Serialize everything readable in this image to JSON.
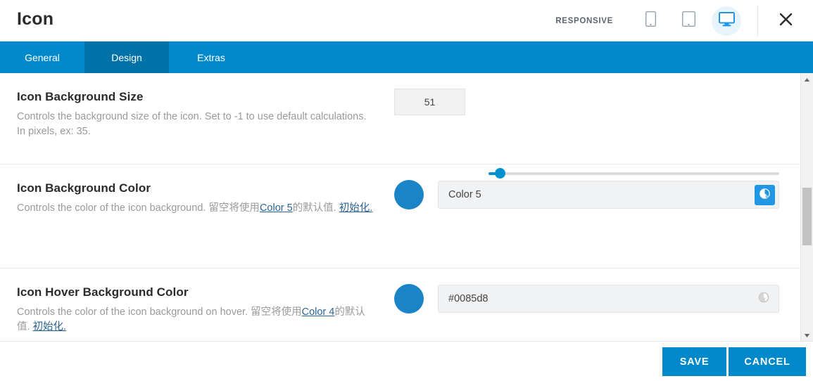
{
  "header": {
    "title": "Icon",
    "responsive_label": "RESPONSIVE",
    "devices": [
      {
        "name": "mobile-icon",
        "label": "Mobile",
        "active": false
      },
      {
        "name": "tablet-icon",
        "label": "Tablet",
        "active": false
      },
      {
        "name": "desktop-icon",
        "label": "Desktop",
        "active": true
      }
    ],
    "close_label": "Close"
  },
  "tabs": [
    {
      "label": "General",
      "active": false
    },
    {
      "label": "Design",
      "active": true
    },
    {
      "label": "Extras",
      "active": false
    }
  ],
  "rows": [
    {
      "label": "Icon Background Size",
      "desc_part1": "Controls the background size of the icon. Set to -1 to use default calculations. In pixels, ex: 35.",
      "value": "51",
      "slider_percent": 4
    },
    {
      "label": "Icon Background Color",
      "desc_part1": "Controls the color of the icon background. 留空将使用",
      "desc_link1": "Color 5",
      "desc_part2": "的默认值. ",
      "desc_link2": "初始化.",
      "value": "Color 5",
      "swatch_color": "#1a84c7",
      "picker_icon": "color-picker-icon"
    },
    {
      "label": "Icon Hover Background Color",
      "desc_part1": "Controls the color of the icon background on hover. 留空将使用",
      "desc_link1": "Color 4",
      "desc_part2": "的默认值. ",
      "desc_link2": "初始化.",
      "value": "#0085d8",
      "swatch_color": "#1a84c7",
      "picker_icon": "color-picker-icon"
    }
  ],
  "footer": {
    "save_label": "SAVE",
    "cancel_label": "CANCEL"
  },
  "colors": {
    "accent": "#0089ca",
    "accent_dark": "#0072a8",
    "slider": "#0092cf",
    "swatch": "#1a84c7",
    "picker_button": "#2196e3"
  }
}
